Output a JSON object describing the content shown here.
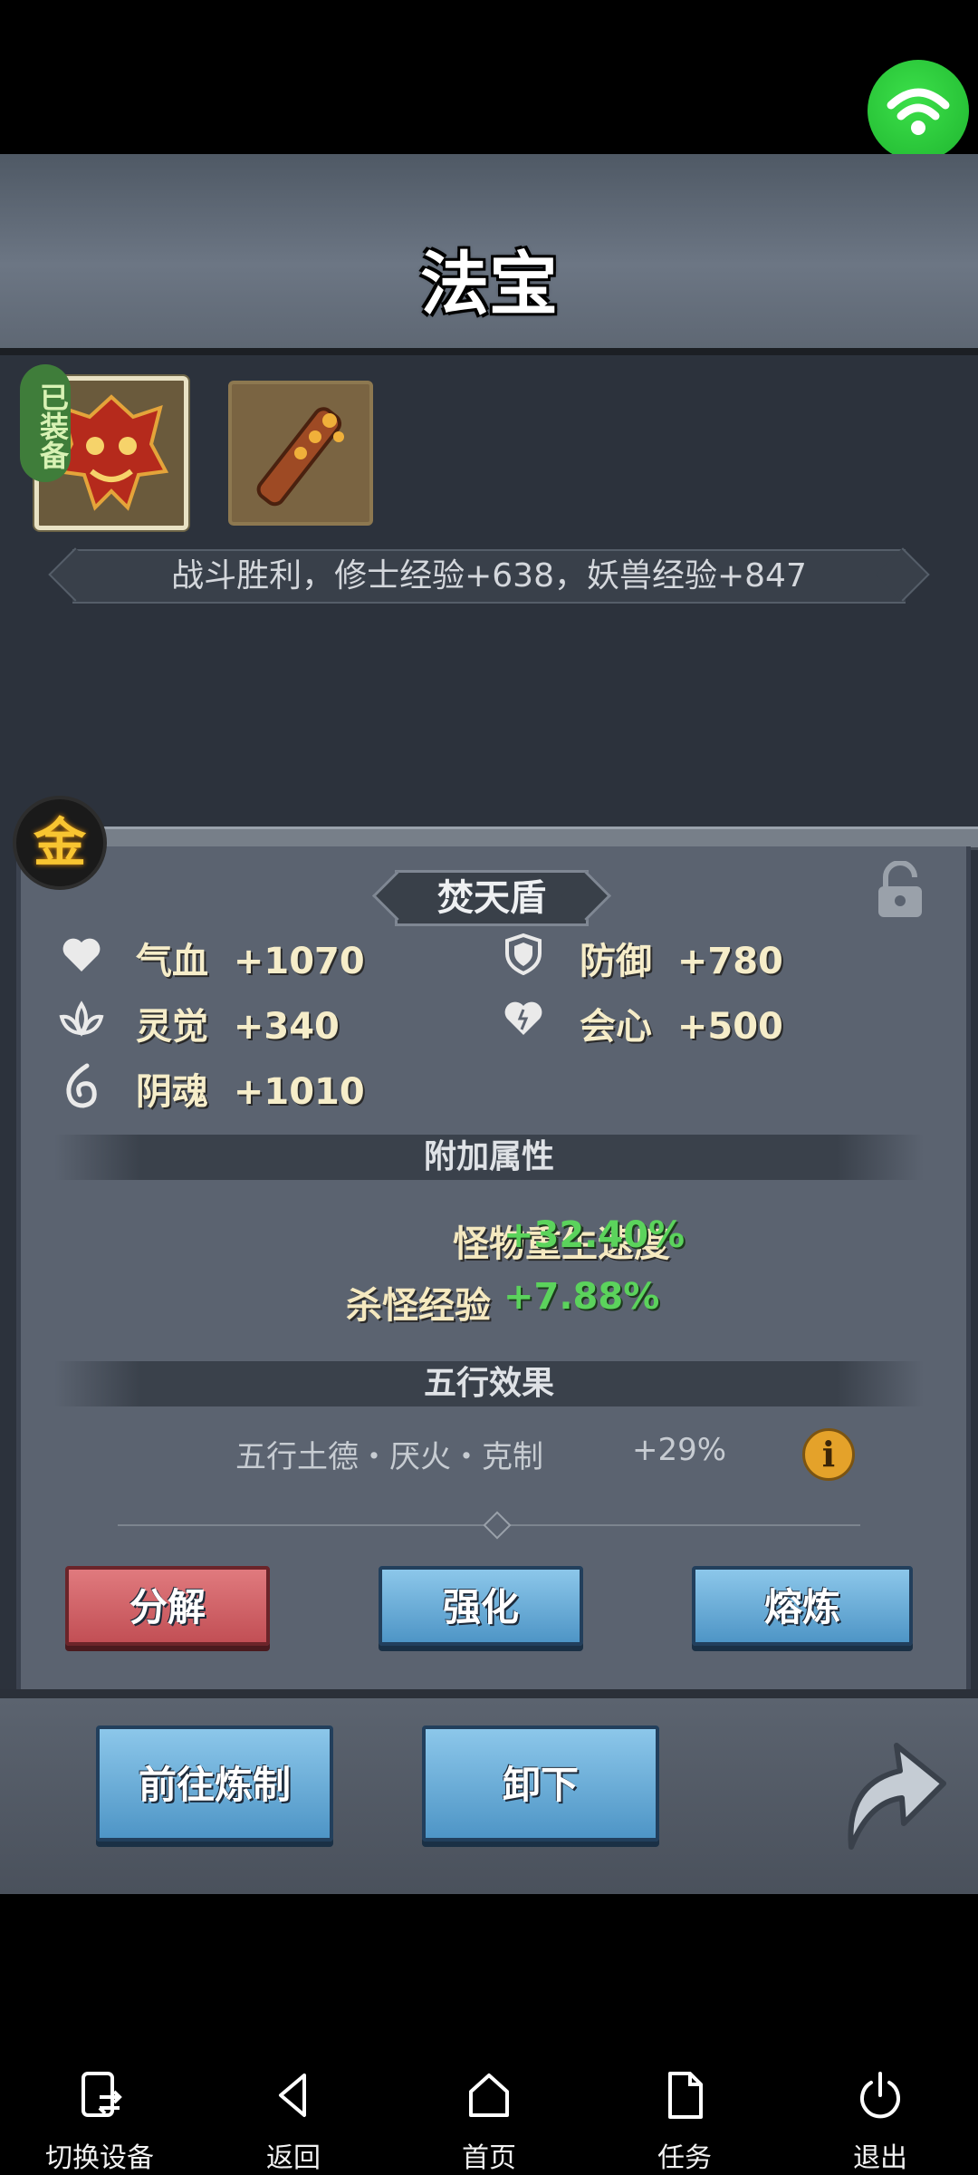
{
  "panel_title": "法宝",
  "equipped_tag": "已装备",
  "battle_message": "战斗胜利，修士经验+638，妖兽经验+847",
  "element_badge": "金",
  "item": {
    "name": "焚天盾",
    "stats": [
      {
        "icon": "heart-icon",
        "label": "气血",
        "value": "+1070"
      },
      {
        "icon": "shield-icon",
        "label": "防御",
        "value": "+780"
      },
      {
        "icon": "lotus-icon",
        "label": "灵觉",
        "value": "+340"
      },
      {
        "icon": "crit-heart-icon",
        "label": "会心",
        "value": "+500"
      },
      {
        "icon": "soul-flame-icon",
        "label": "阴魂",
        "value": "+1010"
      }
    ],
    "extra_section_title": "附加属性",
    "extra_attributes": [
      {
        "label": "怪物重生速度",
        "value": "+32.40%"
      },
      {
        "label": "杀怪经验",
        "value": "+7.88%"
      }
    ],
    "wuxing_section_title": "五行效果",
    "wuxing_effect": "五行土德・厌火・克制",
    "wuxing_value": "+29%"
  },
  "buttons": {
    "decompose": "分解",
    "enhance": "强化",
    "smelt": "熔炼",
    "go_refine": "前往炼制",
    "unequip": "卸下"
  },
  "nav": [
    {
      "icon": "switch-device-icon",
      "label": "切换设备"
    },
    {
      "icon": "back-icon",
      "label": "返回"
    },
    {
      "icon": "home-icon",
      "label": "首页"
    },
    {
      "icon": "task-icon",
      "label": "任务"
    },
    {
      "icon": "power-icon",
      "label": "退出"
    }
  ],
  "colors": {
    "bonus_green": "#5bd35c",
    "stat_text": "#f6edc9",
    "button_blue": "#4e95c6",
    "button_red": "#c24f55",
    "wifi_green": "#1fb52f"
  }
}
